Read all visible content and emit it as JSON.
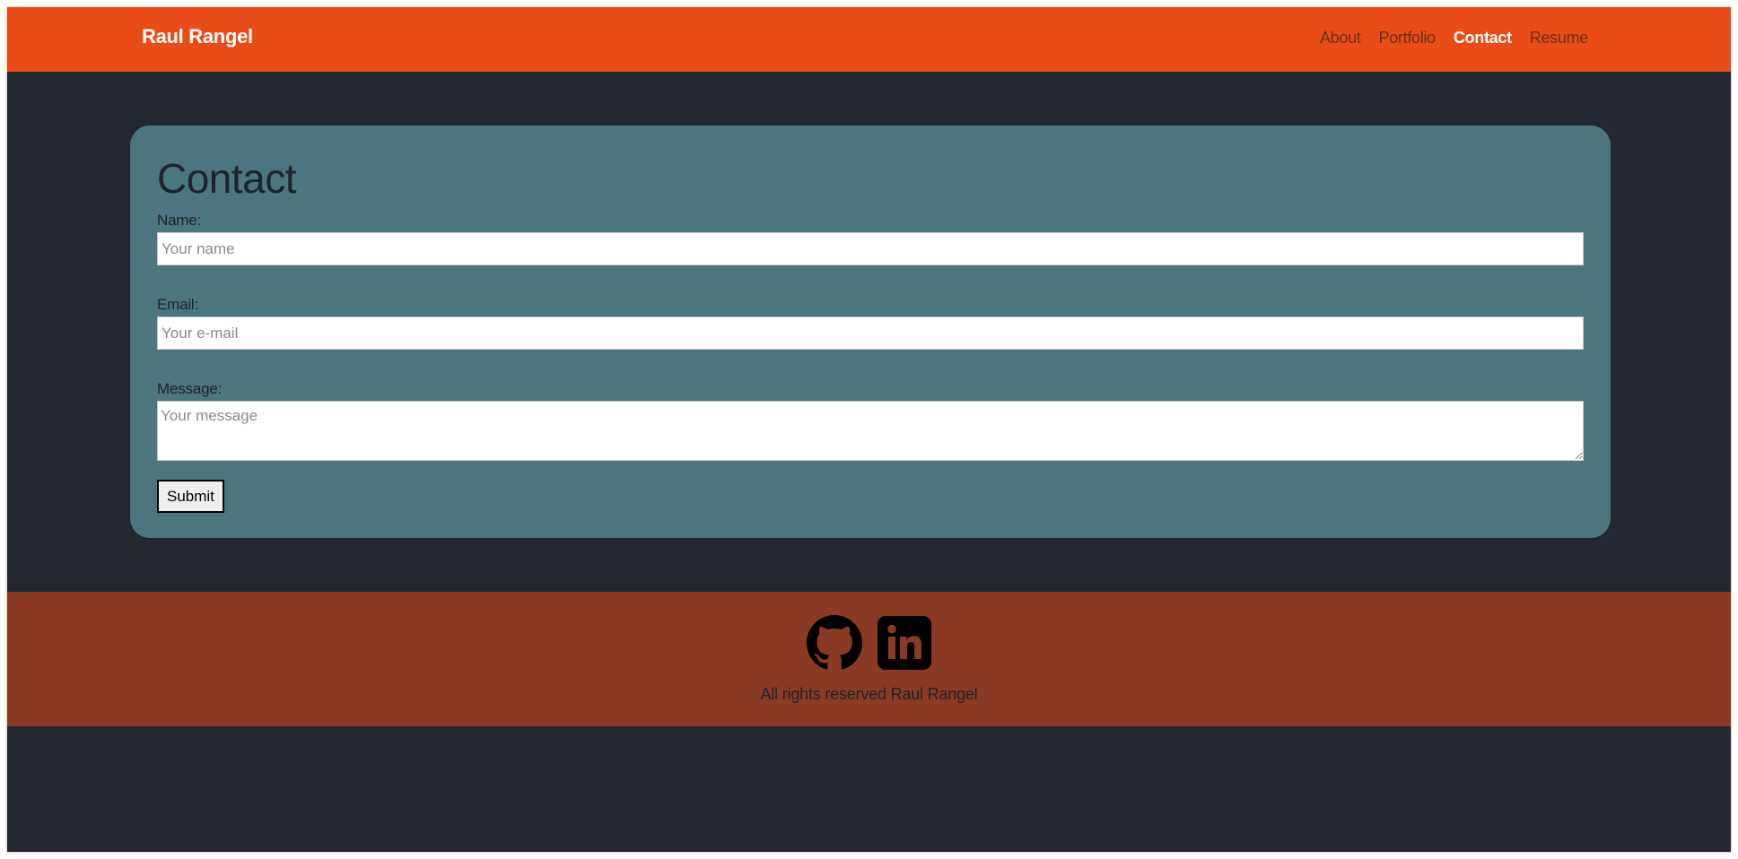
{
  "navbar": {
    "brand": "Raul Rangel",
    "links": [
      {
        "label": "About",
        "active": false
      },
      {
        "label": "Portfolio",
        "active": false
      },
      {
        "label": "Contact",
        "active": true
      },
      {
        "label": "Resume",
        "active": false
      }
    ]
  },
  "contact": {
    "title": "Contact",
    "name_label": "Name:",
    "name_placeholder": "Your name",
    "email_label": "Email:",
    "email_placeholder": "Your e-mail",
    "message_label": "Message:",
    "message_placeholder": "Your message",
    "submit_label": "Submit"
  },
  "footer": {
    "icons": [
      "github-icon",
      "linkedin-icon"
    ],
    "copyright": "All rights reserved Raul Rangel"
  },
  "colors": {
    "navbar_bg": "#e94c17",
    "page_bg": "#222730",
    "card_bg": "#4b767d",
    "footer_bg": "#8a3a22",
    "text_dark": "#1f232a",
    "nav_link": "#6e2f1c",
    "nav_active": "#ffffff"
  }
}
